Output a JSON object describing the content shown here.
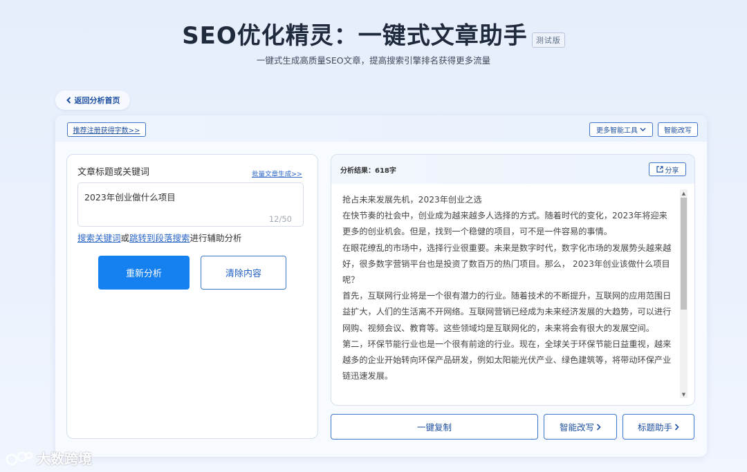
{
  "header": {
    "title": "SEO优化精灵：一键式文章助手",
    "badge": "测试版",
    "subtitle": "一键式生成高质量SEO文章，提高搜索引擎排名获得更多流量"
  },
  "back_button": {
    "label": "返回分析首页"
  },
  "toolbar": {
    "register_label": "推荐注册获得字数>>",
    "more_tools_label": "更多智能工具",
    "smart_rewrite_label": "智能改写"
  },
  "left": {
    "label": "文章标题或关键词",
    "batch_link": "批量文章生成>>",
    "input_value": "2023年创业做什么项目",
    "counter": "12/50",
    "assist": {
      "link1": "搜索关键词",
      "or": "或",
      "link2": "跳转到段落搜索",
      "suffix": "进行辅助分析"
    },
    "reanalyze_label": "重新分析",
    "clear_label": "清除内容"
  },
  "right": {
    "result_label": "分析结果：618字",
    "share_label": "分享",
    "paragraphs": [
      "抢占未来发展先机，2023年创业之选",
      "在快节奏的社会中，创业成为越来越多人选择的方式。随着时代的变化，2023年将迎来更多的创业机会。但是，找到一个稳健的项目，可不是一件容易的事情。",
      "在眼花缭乱的市场中，选择行业很重要。未来是数字时代，数字化市场的发展势头越来越好，很多数字营销平台也是投资了数百万的热门项目。那么， 2023年创业该做什么项目呢？",
      "首先，互联网行业将是一个很有潜力的行业。随着技术的不断提升，互联网的应用范围日益扩大，人们的生活离不开网络。互联网营销已经成为未来经济发展的大趋势，可以进行网购、视频会议、教育等。这些领域均是互联网化的，未来将会有很大的发展空间。",
      "第二，环保节能行业也是一个很有前途的行业。现在，全球关于环保节能日益重视，越来越多的企业开始转向环保产品研发，例如太阳能光伏产业、绿色建筑等，将带动环保产业链迅速发展。"
    ],
    "copy_label": "一键复制",
    "rewrite_label": "智能改写",
    "title_helper_label": "标题助手"
  },
  "watermark": "大数跨境"
}
